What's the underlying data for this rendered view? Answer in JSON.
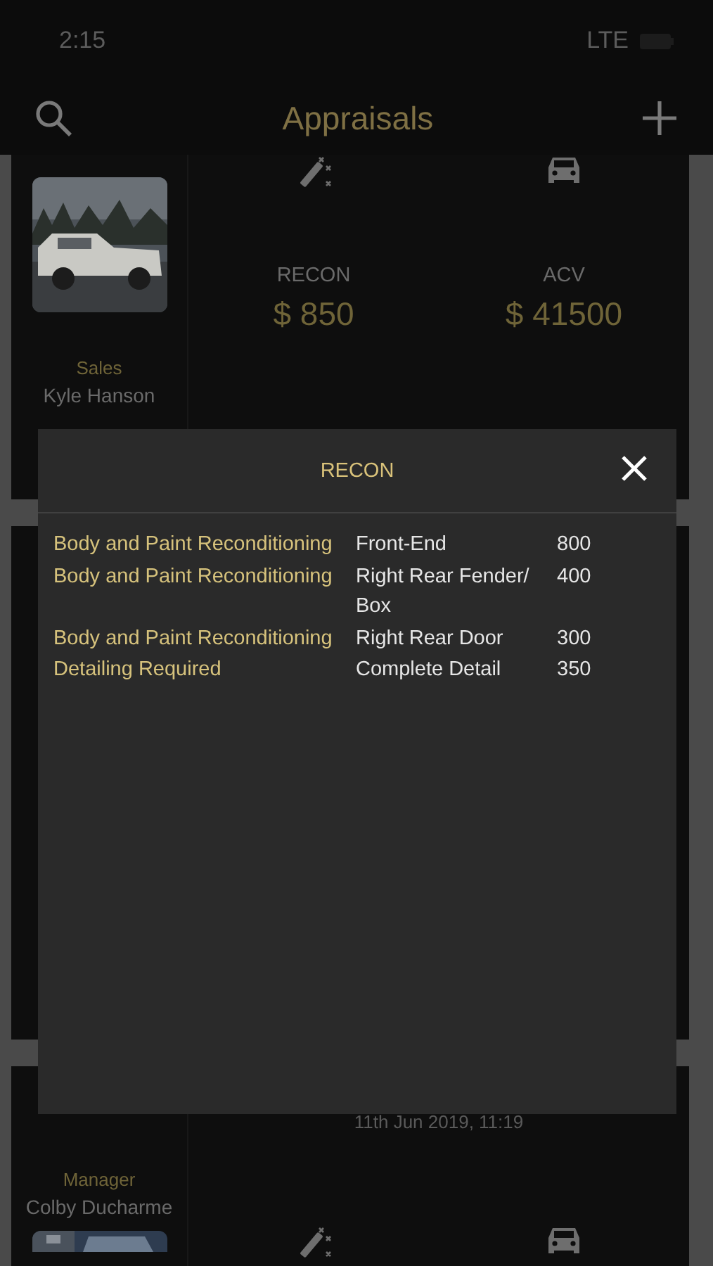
{
  "status_bar": {
    "time": "2:15",
    "network": "LTE"
  },
  "header": {
    "title": "Appraisals"
  },
  "cards": [
    {
      "kind": "summary",
      "role": "Sales",
      "name": "Kyle Hanson",
      "stats": [
        {
          "label": "RECON",
          "value": "$ 850"
        },
        {
          "label": "ACV",
          "value": "$ 41500"
        }
      ]
    },
    {
      "kind": "hidden"
    },
    {
      "kind": "dated",
      "role": "Manager",
      "name": "Colby Ducharme",
      "date": "11th Jun 2019, 11:19"
    }
  ],
  "modal": {
    "title": "RECON",
    "rows": [
      {
        "category": "Body and Paint Reconditioning",
        "item": "Front-End",
        "amount": "800"
      },
      {
        "category": "Body and Paint Reconditioning",
        "item": "Right Rear Fender/ Box",
        "amount": "400"
      },
      {
        "category": "Body and Paint Reconditioning",
        "item": "Right Rear Door",
        "amount": "300"
      },
      {
        "category": "Detailing Required",
        "item": "Complete Detail",
        "amount": "350"
      }
    ]
  }
}
